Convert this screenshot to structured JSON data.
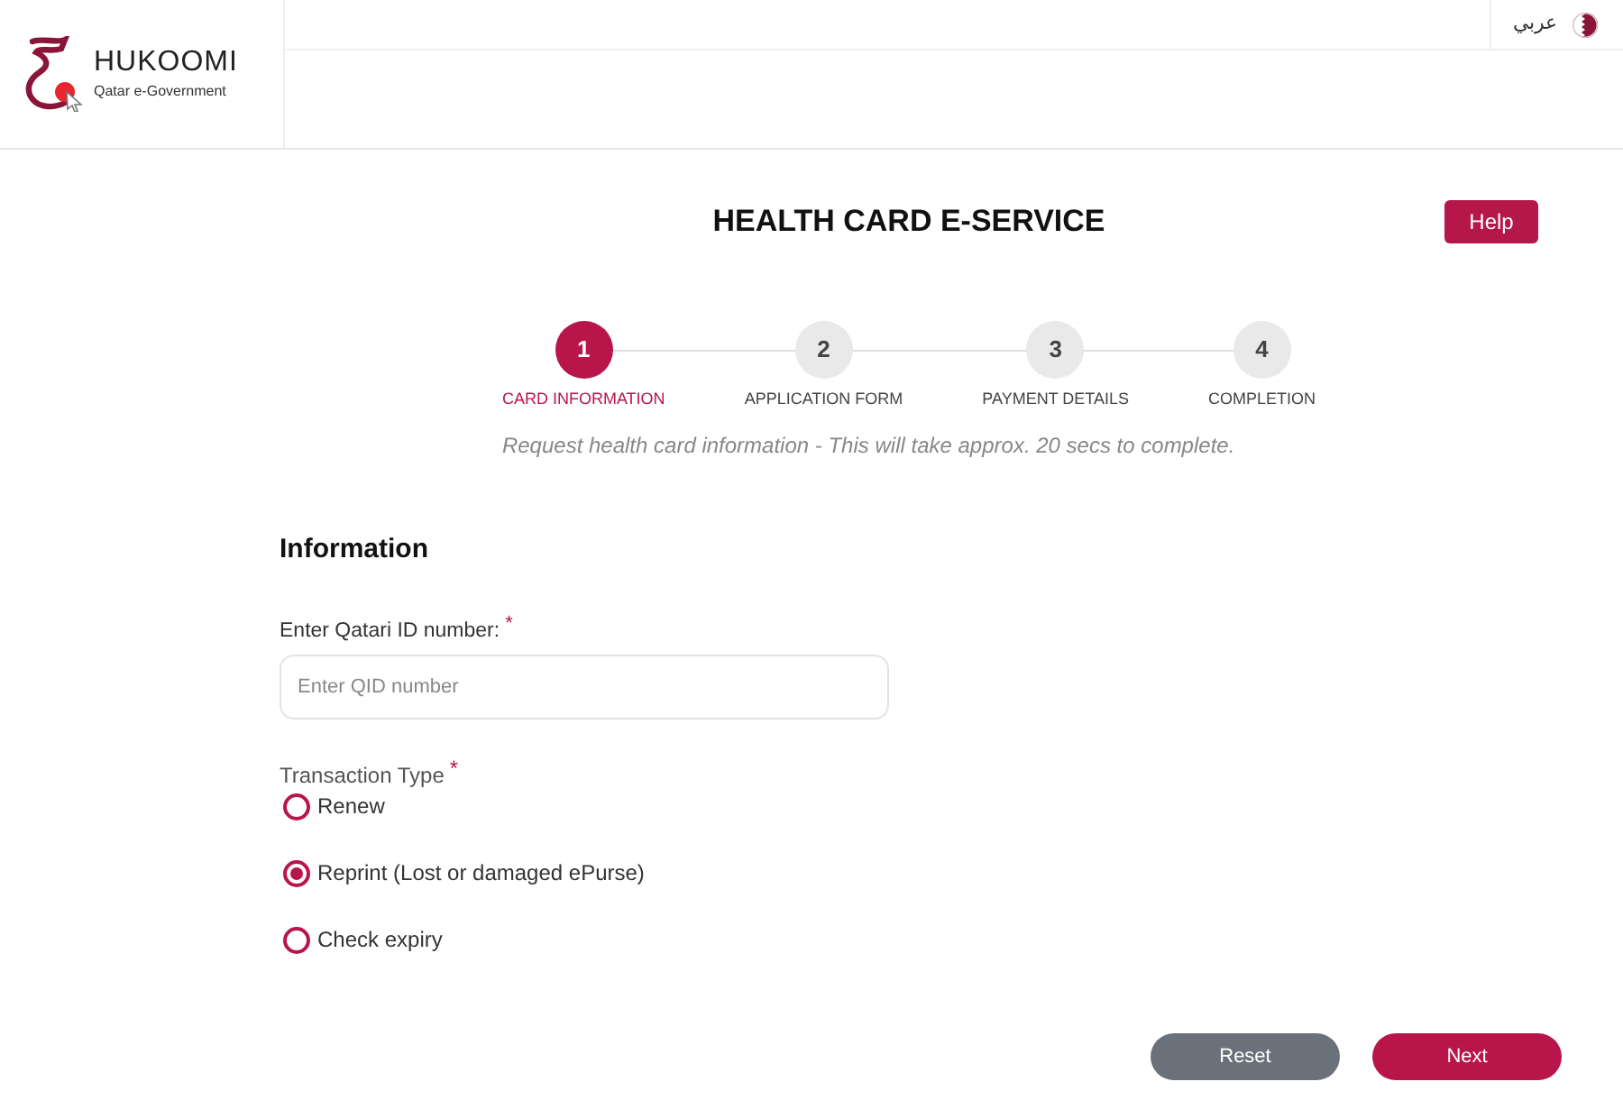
{
  "header": {
    "logo": {
      "title": "HUKOOMI",
      "subtitle": "Qatar e-Government"
    },
    "language_link": "عربي"
  },
  "page_title": "HEALTH CARD E-SERVICE",
  "help_button": "Help",
  "steps": [
    {
      "number": "1",
      "label": "CARD INFORMATION",
      "selected": true
    },
    {
      "number": "2",
      "label": "APPLICATION FORM",
      "selected": false
    },
    {
      "number": "3",
      "label": "PAYMENT DETAILS",
      "selected": false
    },
    {
      "number": "4",
      "label": "COMPLETION",
      "selected": false
    }
  ],
  "step_hint": "Request health card information - This will take approx. 20 secs to complete.",
  "section_title": "Information",
  "qid_field": {
    "label": "Enter Qatari ID number:",
    "required_mark": "*",
    "placeholder": "Enter QID number"
  },
  "transaction_type": {
    "label": "Transaction Type",
    "required_mark": "*",
    "options": [
      {
        "label": "Renew",
        "selected": false
      },
      {
        "label": "Reprint (Lost or damaged ePurse)",
        "selected": true
      },
      {
        "label": "Check expiry",
        "selected": false
      }
    ]
  },
  "buttons": [
    {
      "label": "Reset",
      "kind": "secondary"
    },
    {
      "label": "Next",
      "kind": "primary"
    }
  ]
}
